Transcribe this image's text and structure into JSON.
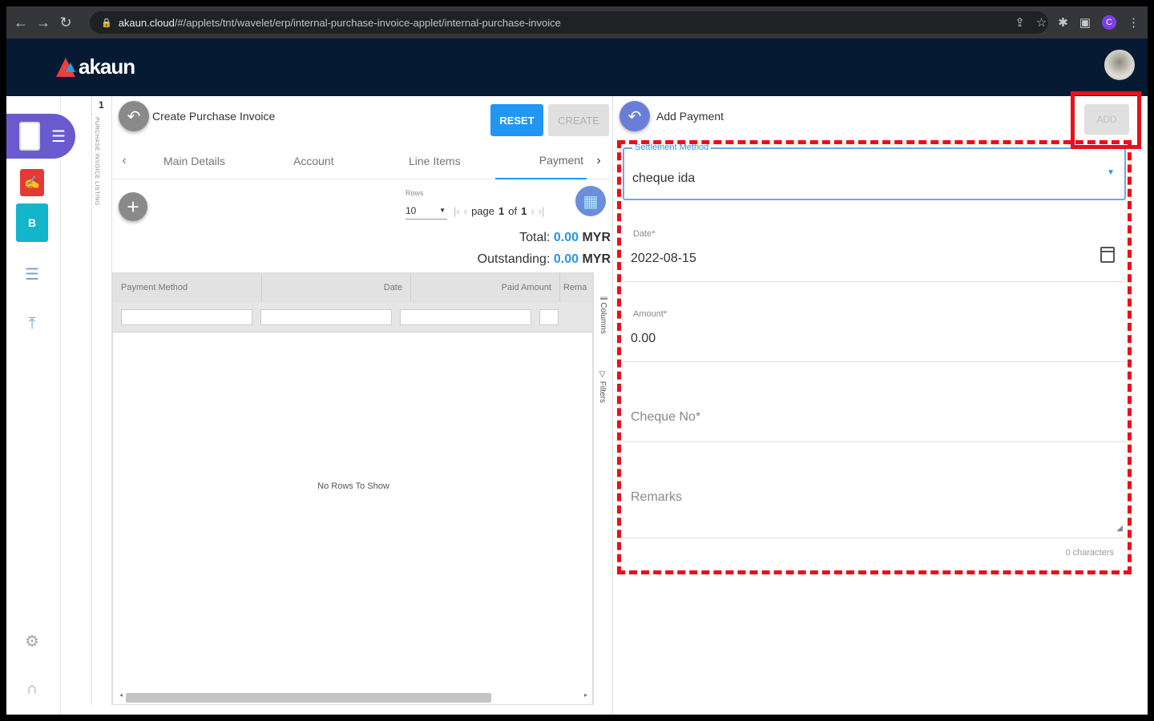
{
  "browser": {
    "url_domain": "akaun.cloud",
    "url_path": "/#/applets/tnt/wavelet/erp/internal-purchase-invoice-applet/internal-purchase-invoice",
    "profile_initial": "C"
  },
  "app": {
    "logo_text": "akaun"
  },
  "strip": {
    "number": "1",
    "vertical_text": "PURCHASE INVOICE LISTING"
  },
  "left_panel": {
    "title": "Create Purchase Invoice",
    "reset_label": "RESET",
    "create_label": "CREATE",
    "tabs": [
      {
        "label": "Main Details",
        "active": false
      },
      {
        "label": "Account",
        "active": false
      },
      {
        "label": "Line Items",
        "active": false
      },
      {
        "label": "Payment",
        "active": true
      }
    ],
    "rows_label": "Rows",
    "rows_value": "10",
    "pager": {
      "page_word": "page",
      "current": "1",
      "of_word": "of",
      "total": "1"
    },
    "total_label": "Total:",
    "total_value": "0.00",
    "outstanding_label": "Outstanding:",
    "outstanding_value": "0.00",
    "currency": "MYR",
    "grid": {
      "columns": [
        "Payment Method",
        "Date",
        "Paid Amount",
        "Rema"
      ],
      "empty_text": "No Rows To Show"
    },
    "side_tools": [
      "Columns",
      "Filters"
    ]
  },
  "right_panel": {
    "title": "Add Payment",
    "add_label": "ADD",
    "settlement_label": "Settlement Method",
    "settlement_value": "cheque ida",
    "date_label": "Date*",
    "date_value": "2022-08-15",
    "amount_label": "Amount*",
    "amount_value": "0.00",
    "cheque_placeholder": "Cheque No*",
    "remarks_placeholder": "Remarks",
    "char_count": "0 characters"
  },
  "colors": {
    "header_bg": "#061a33",
    "primary": "#2196f3",
    "annotation": "#e8101a",
    "sidebar_active": "#6a5acd"
  }
}
